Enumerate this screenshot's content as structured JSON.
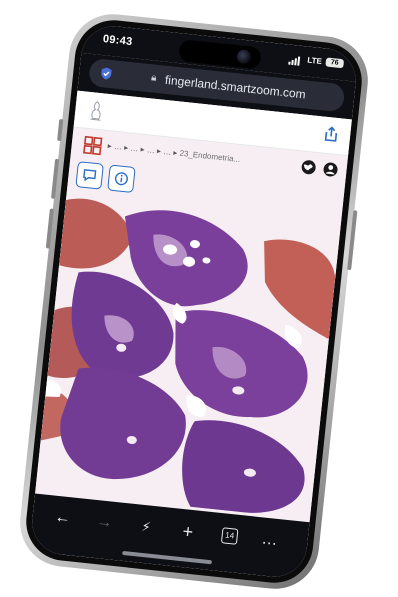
{
  "status_bar": {
    "time": "09:43",
    "network": "LTE",
    "battery": "76"
  },
  "browser": {
    "url": "fingerland.smartzoom.com",
    "lock_icon": "lock-icon",
    "shield_icon": "shield-icon"
  },
  "viewer": {
    "breadcrumb": {
      "separators": [
        "…",
        "…",
        "…",
        "…"
      ],
      "current": "23_Endometria..."
    },
    "icons": [
      "grid-icon",
      "globe-icon",
      "user-icon",
      "annotation-icon",
      "info-icon"
    ]
  },
  "toolbar": {
    "back": "←",
    "forward": "→",
    "ai": "⚡",
    "new_tab": "+",
    "tabs_count": "14",
    "more": "…"
  },
  "colors": {
    "accent_blue": "#2b6cc4",
    "tissue_purple": "#7a3f9a",
    "tissue_red": "#b0423a"
  }
}
